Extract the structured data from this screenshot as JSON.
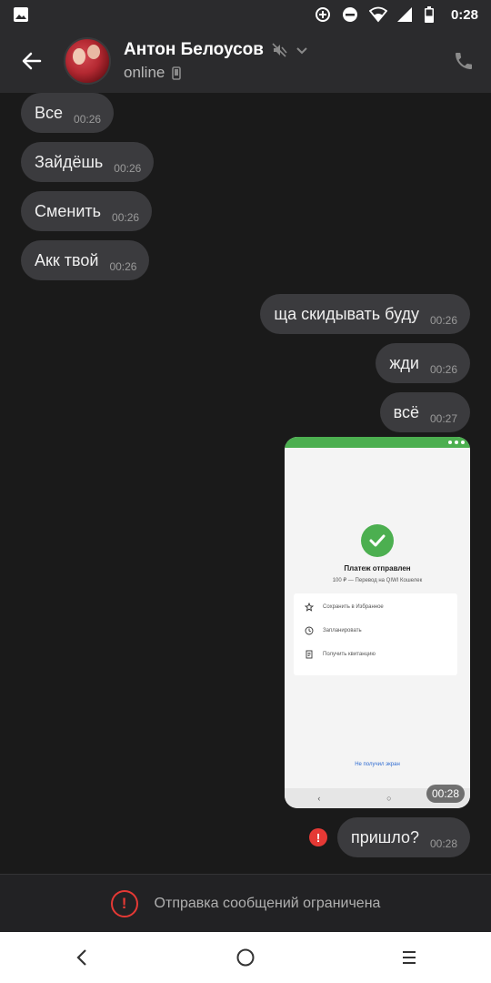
{
  "status_bar": {
    "time": "0:28"
  },
  "header": {
    "contact_name": "Антон Белоусов",
    "contact_status": "online"
  },
  "messages": [
    {
      "dir": "in",
      "text": "Все",
      "time": "00:26"
    },
    {
      "dir": "in",
      "text": "Зайдёшь",
      "time": "00:26"
    },
    {
      "dir": "in",
      "text": "Сменить",
      "time": "00:26"
    },
    {
      "dir": "in",
      "text": "Акк твой",
      "time": "00:26"
    },
    {
      "dir": "out",
      "text": "ща скидывать буду",
      "time": "00:26"
    },
    {
      "dir": "out",
      "text": "жди",
      "time": "00:26"
    },
    {
      "dir": "out",
      "text": "всё",
      "time": "00:27"
    }
  ],
  "image_message": {
    "time": "00:28",
    "title": "Платеж отправлен",
    "subtitle": "100 ₽ — Перевод на QIWI Кошелек",
    "rows": [
      "Сохранить в Избранное",
      "Запланировать",
      "Получить квитанцию"
    ],
    "link": "Не получил экран"
  },
  "failed_message": {
    "text": "пришло?",
    "time": "00:28",
    "error_mark": "!"
  },
  "restricted": {
    "text": "Отправка сообщений ограничена",
    "mark": "!"
  },
  "colors": {
    "accent_red": "#e53935",
    "bubble": "#3b3b3e",
    "background": "#1a1a1a",
    "success_green": "#4caf50"
  }
}
